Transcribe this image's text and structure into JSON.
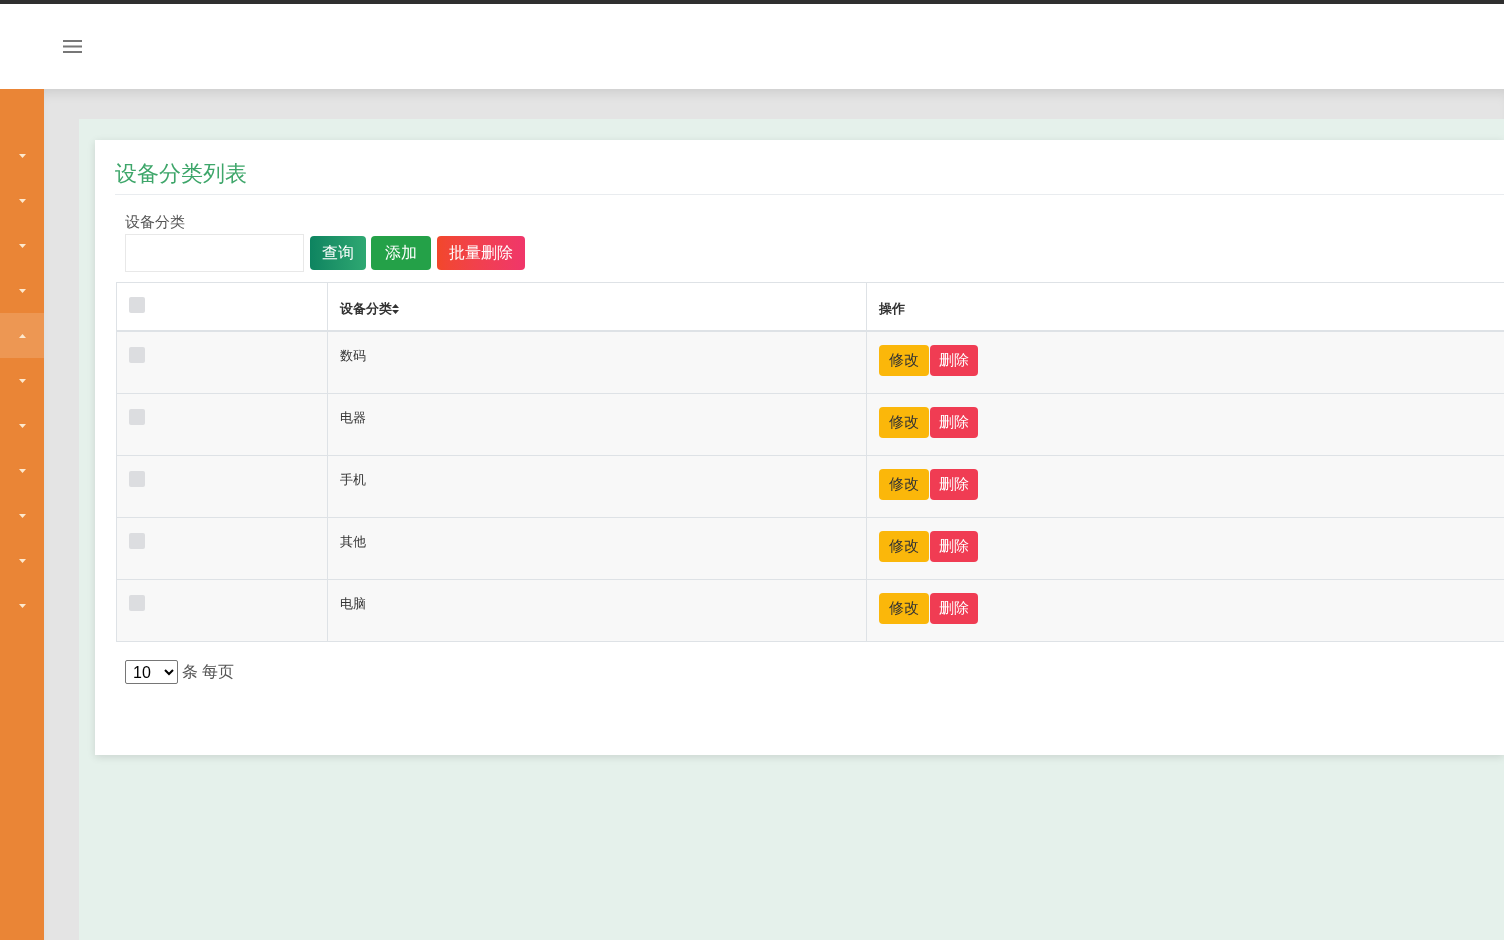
{
  "sidebar": {
    "items": [
      {
        "expanded": false
      },
      {
        "expanded": false
      },
      {
        "expanded": false
      },
      {
        "expanded": false
      },
      {
        "expanded": true
      },
      {
        "expanded": false
      },
      {
        "expanded": false
      },
      {
        "expanded": false
      },
      {
        "expanded": false
      },
      {
        "expanded": false
      },
      {
        "expanded": false
      }
    ]
  },
  "card": {
    "title": "设备分类列表"
  },
  "search": {
    "label": "设备分类"
  },
  "buttons": [
    {
      "label": "查询",
      "kind": "search"
    },
    {
      "label": "添加",
      "kind": "add"
    },
    {
      "label": "批量删除",
      "kind": "batch_delete"
    }
  ],
  "table": {
    "columns": [
      {
        "kind": "checkbox",
        "checked": false
      },
      {
        "kind": "text",
        "label": "设备分类",
        "sortable": true
      },
      {
        "kind": "actions",
        "label": "操作"
      }
    ],
    "rows": [
      {
        "checked": false,
        "category": "数码",
        "actions": [
          {
            "label": "修改",
            "kind": "edit"
          },
          {
            "label": "删除",
            "kind": "delete"
          }
        ]
      },
      {
        "checked": false,
        "category": "电器",
        "actions": [
          {
            "label": "修改",
            "kind": "edit"
          },
          {
            "label": "删除",
            "kind": "delete"
          }
        ]
      },
      {
        "checked": false,
        "category": "手机",
        "actions": [
          {
            "label": "修改",
            "kind": "edit"
          },
          {
            "label": "删除",
            "kind": "delete"
          }
        ]
      },
      {
        "checked": false,
        "category": "其他",
        "actions": [
          {
            "label": "修改",
            "kind": "edit"
          },
          {
            "label": "删除",
            "kind": "delete"
          }
        ]
      },
      {
        "checked": false,
        "category": "电脑",
        "actions": [
          {
            "label": "修改",
            "kind": "edit"
          },
          {
            "label": "删除",
            "kind": "delete"
          }
        ]
      }
    ]
  },
  "pagination": {
    "page_size": "10",
    "unit": "条 每页"
  }
}
